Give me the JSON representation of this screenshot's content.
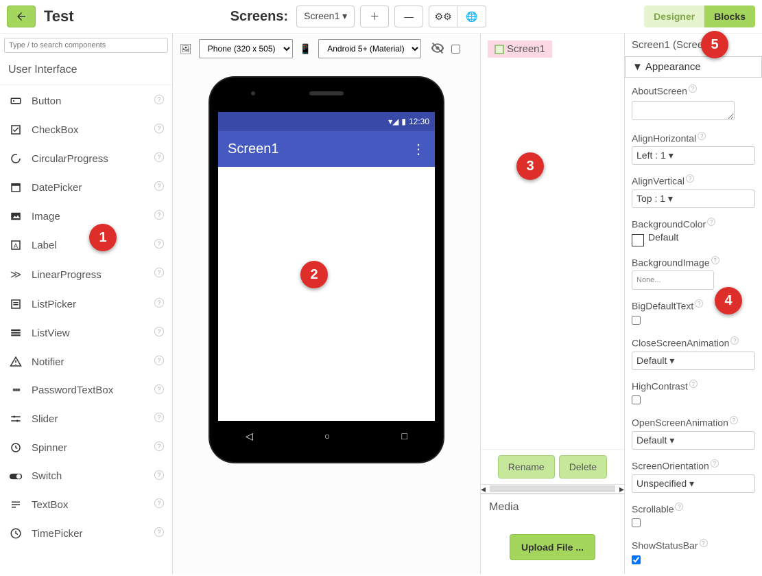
{
  "header": {
    "project_title": "Test",
    "screens_label": "Screens:",
    "current_screen": "Screen1",
    "designer_label": "Designer",
    "blocks_label": "Blocks"
  },
  "palette": {
    "search_placeholder": "Type / to search components",
    "category": "User Interface",
    "components": [
      {
        "name": "Button",
        "icon": "button-icon"
      },
      {
        "name": "CheckBox",
        "icon": "checkbox-icon"
      },
      {
        "name": "CircularProgress",
        "icon": "circular-progress-icon"
      },
      {
        "name": "DatePicker",
        "icon": "datepicker-icon"
      },
      {
        "name": "Image",
        "icon": "image-icon"
      },
      {
        "name": "Label",
        "icon": "label-icon"
      },
      {
        "name": "LinearProgress",
        "icon": "linear-progress-icon"
      },
      {
        "name": "ListPicker",
        "icon": "listpicker-icon"
      },
      {
        "name": "ListView",
        "icon": "listview-icon"
      },
      {
        "name": "Notifier",
        "icon": "notifier-icon"
      },
      {
        "name": "PasswordTextBox",
        "icon": "password-icon"
      },
      {
        "name": "Slider",
        "icon": "slider-icon"
      },
      {
        "name": "Spinner",
        "icon": "spinner-icon"
      },
      {
        "name": "Switch",
        "icon": "switch-icon"
      },
      {
        "name": "TextBox",
        "icon": "textbox-icon"
      },
      {
        "name": "TimePicker",
        "icon": "timepicker-icon"
      }
    ]
  },
  "viewer": {
    "size_select": "Phone (320 x 505)",
    "theme_select": "Android 5+ (Material)",
    "clock": "12:30",
    "screen_title": "Screen1"
  },
  "tree": {
    "root": "Screen1",
    "rename_label": "Rename",
    "delete_label": "Delete",
    "media_header": "Media",
    "upload_label": "Upload File ..."
  },
  "properties": {
    "title": "Screen1 (Screen)",
    "section": "Appearance",
    "items": {
      "AboutScreen": {
        "label": "AboutScreen",
        "value": ""
      },
      "AlignHorizontal": {
        "label": "AlignHorizontal",
        "value": "Left : 1"
      },
      "AlignVertical": {
        "label": "AlignVertical",
        "value": "Top : 1"
      },
      "BackgroundColor": {
        "label": "BackgroundColor",
        "value": "Default"
      },
      "BackgroundImage": {
        "label": "BackgroundImage",
        "value": "None..."
      },
      "BigDefaultText": {
        "label": "BigDefaultText",
        "checked": false
      },
      "CloseScreenAnimation": {
        "label": "CloseScreenAnimation",
        "value": "Default"
      },
      "HighContrast": {
        "label": "HighContrast",
        "checked": false
      },
      "OpenScreenAnimation": {
        "label": "OpenScreenAnimation",
        "value": "Default"
      },
      "ScreenOrientation": {
        "label": "ScreenOrientation",
        "value": "Unspecified"
      },
      "Scrollable": {
        "label": "Scrollable",
        "checked": false
      },
      "ShowStatusBar": {
        "label": "ShowStatusBar",
        "checked": true
      }
    }
  },
  "callouts": [
    "1",
    "2",
    "3",
    "4",
    "5"
  ]
}
